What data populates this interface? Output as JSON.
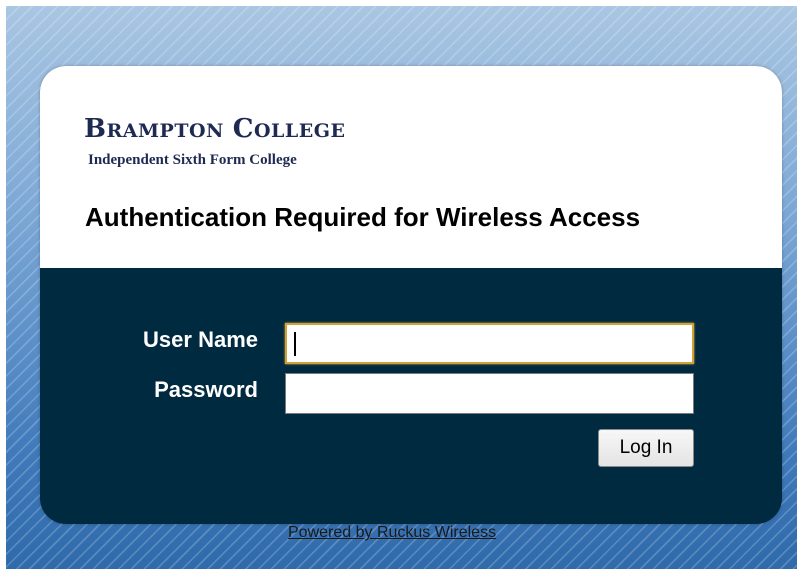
{
  "brand": {
    "name_first_initial": "B",
    "name_first_rest": "RAMPTON",
    "name_second_initial": "C",
    "name_second_rest": "OLLEGE",
    "subtitle": "Independent Sixth Form College"
  },
  "page": {
    "title": "Authentication Required for Wireless Access"
  },
  "form": {
    "username_label": "User Name",
    "username_value": "",
    "password_label": "Password",
    "password_value": "",
    "login_label": "Log In"
  },
  "footer": {
    "powered_by": "Powered by Ruckus Wireless"
  },
  "colors": {
    "panel_background": "#002a40",
    "header_background": "#ffffff",
    "brand_text": "#1f2a52",
    "focused_input_border": "#d4a234"
  }
}
